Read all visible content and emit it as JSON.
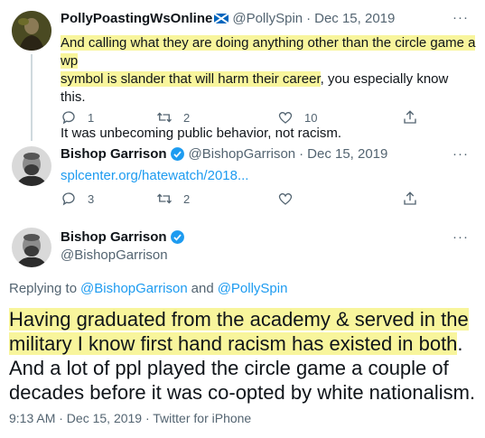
{
  "tweet1": {
    "display_name": "PollyPoastingWsOnline",
    "handle": "@PollySpin",
    "date": "Dec 15, 2019",
    "text_highlighted_1": "And calling what they are doing anything other than the circle game a wp",
    "text_highlighted_2": "symbol is slander that will harm their career",
    "text_rest_2": ", you especially know this.",
    "text_para2": "It was unbecoming public behavior, not racism.",
    "replies": "1",
    "retweets": "2",
    "likes": "10"
  },
  "tweet2": {
    "display_name": "Bishop Garrison",
    "handle": "@BishopGarrison",
    "date": "Dec 15, 2019",
    "link": "splcenter.org/hatewatch/2018...",
    "replies": "3",
    "retweets": "2"
  },
  "main_tweet": {
    "display_name": "Bishop Garrison",
    "handle": "@BishopGarrison",
    "replying_prefix": "Replying to",
    "reply_to_1": "@BishopGarrison",
    "reply_and": "and",
    "reply_to_2": "@PollySpin",
    "text_highlighted_1": "Having graduated from the academy & served in the",
    "text_highlighted_2": "military I know first hand racism has existed in both",
    "text_rest_2": ".",
    "text_line_3": "And a lot of ppl played the circle game a couple of",
    "text_line_4": "decades before it was co-opted by white nationalism.",
    "timestamp": "9:13 AM · Dec 15, 2019 · Twitter for iPhone"
  },
  "separator": "·",
  "more_label": "···",
  "colors": {
    "accent": "#1d9bf0",
    "highlight": "#f8f59c",
    "muted": "#536471"
  },
  "icons": [
    "reply-icon",
    "retweet-icon",
    "like-icon",
    "share-icon",
    "verified-badge-icon",
    "scotland-flag-icon",
    "more-icon"
  ]
}
